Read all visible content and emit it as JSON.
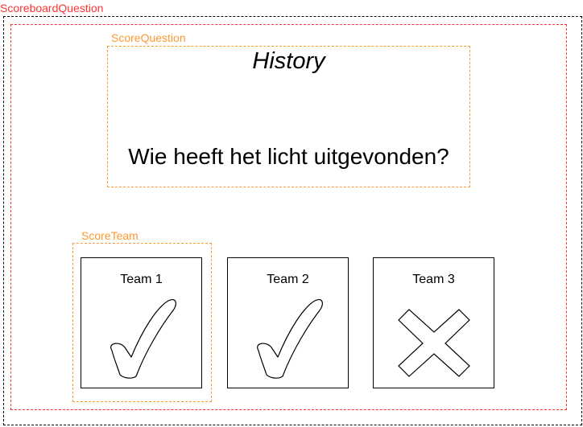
{
  "scoreboard_question": {
    "label": "ScoreboardQuestion"
  },
  "score_question": {
    "label": "ScoreQuestion",
    "category": "History",
    "question": "Wie heeft het licht uitgevonden?"
  },
  "score_team": {
    "label": "ScoreTeam"
  },
  "teams": [
    {
      "name": "Team 1",
      "result": "correct",
      "icon": "checkmark-icon"
    },
    {
      "name": "Team 2",
      "result": "correct",
      "icon": "checkmark-icon"
    },
    {
      "name": "Team 3",
      "result": "wrong",
      "icon": "cross-icon"
    }
  ],
  "colors": {
    "outer_frame": "#000000",
    "scoreboard_label": "#ff3333",
    "inner_frame": "#ff3333",
    "component_frame": "#ff9933"
  }
}
